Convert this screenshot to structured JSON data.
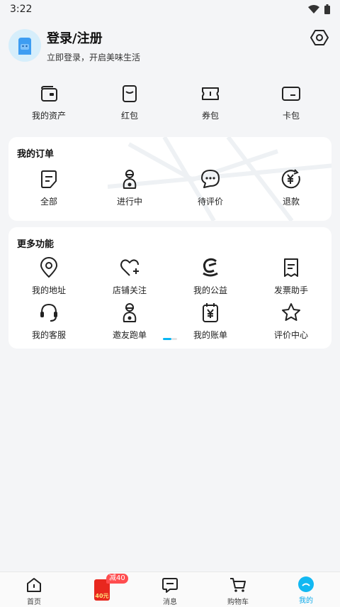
{
  "status_bar": {
    "time": "3:22"
  },
  "header": {
    "login_title": "登录/注册",
    "login_subtitle": "立即登录，开启美味生活"
  },
  "assets": [
    {
      "label": "我的资产",
      "icon": "wallet-icon"
    },
    {
      "label": "红包",
      "icon": "red-packet-icon"
    },
    {
      "label": "券包",
      "icon": "coupon-icon"
    },
    {
      "label": "卡包",
      "icon": "card-icon"
    }
  ],
  "orders": {
    "title": "我的订单",
    "items": [
      {
        "label": "全部",
        "icon": "order-list-icon"
      },
      {
        "label": "进行中",
        "icon": "rider-icon"
      },
      {
        "label": "待评价",
        "icon": "comment-icon"
      },
      {
        "label": "退款",
        "icon": "refund-icon"
      }
    ]
  },
  "functions": {
    "title": "更多功能",
    "row1": [
      {
        "label": "我的地址",
        "icon": "location-icon"
      },
      {
        "label": "店铺关注",
        "icon": "heart-plus-icon"
      },
      {
        "label": "我的公益",
        "icon": "charity-icon"
      },
      {
        "label": "发票助手",
        "icon": "invoice-icon"
      }
    ],
    "row2": [
      {
        "label": "我的客服",
        "icon": "headset-icon"
      },
      {
        "label": "邀友跑单",
        "icon": "rider-icon"
      },
      {
        "label": "我的账单",
        "icon": "bill-icon"
      },
      {
        "label": "评价中心",
        "icon": "star-icon"
      }
    ]
  },
  "tabbar": {
    "items": [
      {
        "label": "首页",
        "icon": "home-icon"
      },
      {
        "label": "",
        "icon": "promo-bag-icon",
        "badge": "减40",
        "bag_text": "40元"
      },
      {
        "label": "消息",
        "icon": "message-icon"
      },
      {
        "label": "购物车",
        "icon": "cart-icon"
      },
      {
        "label": "我的",
        "icon": "profile-icon",
        "active": true
      }
    ]
  },
  "colors": {
    "accent": "#09b6f3",
    "badge": "#ff4d4f",
    "background": "#f4f5f7"
  }
}
